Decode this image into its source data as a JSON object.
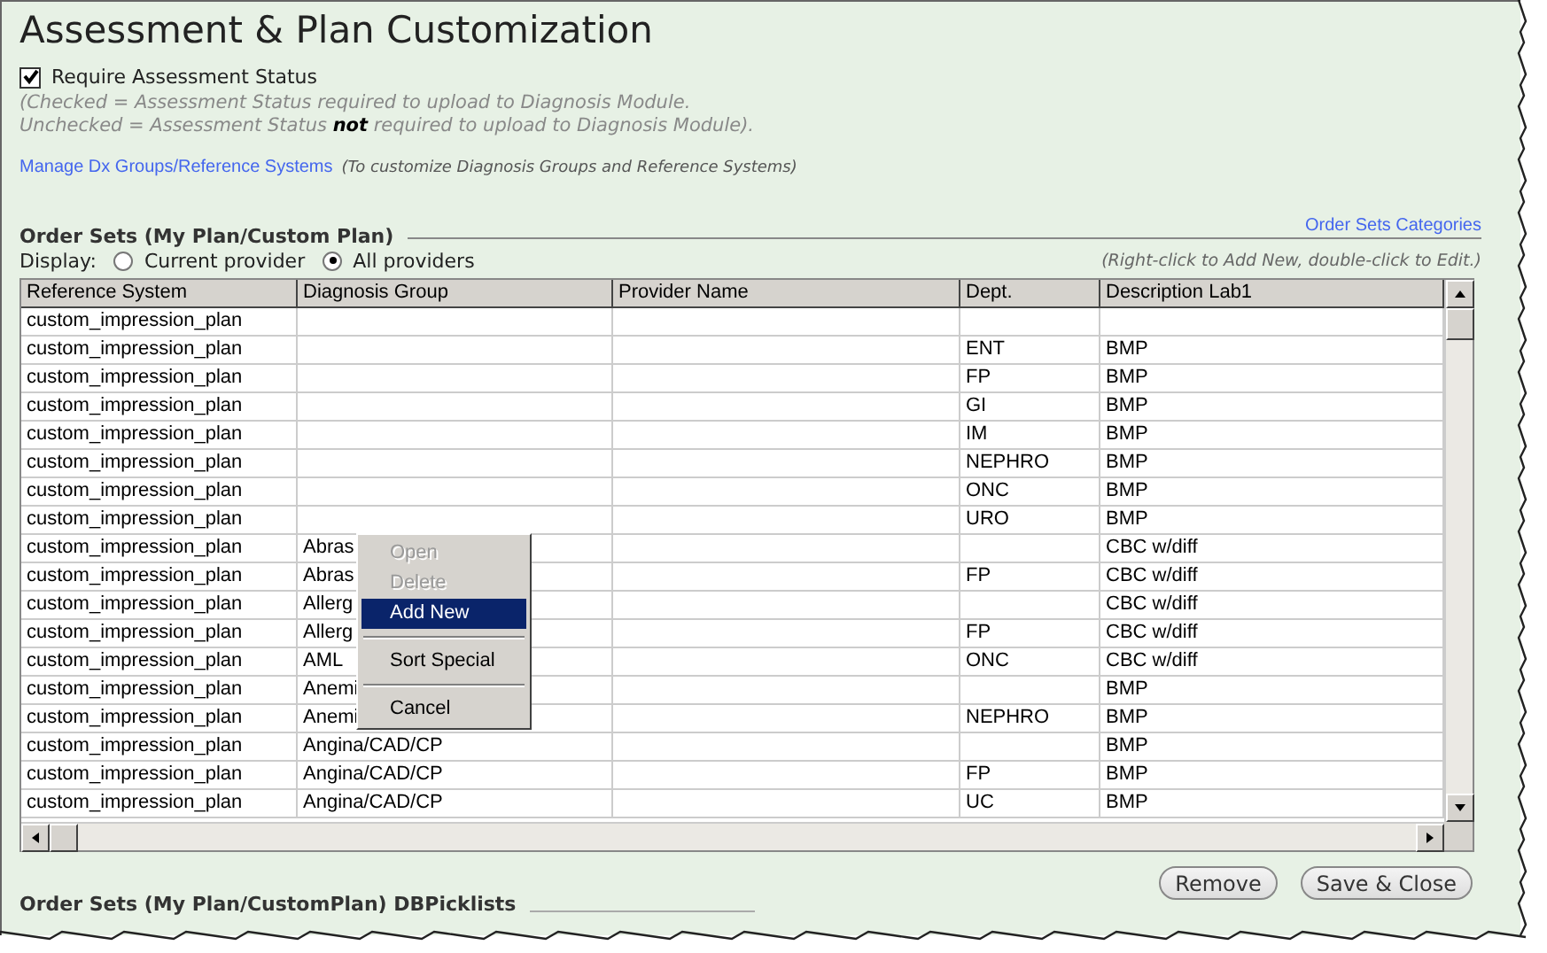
{
  "title": "Assessment & Plan Customization",
  "require_status": {
    "label": "Require Assessment Status",
    "checked": true
  },
  "status_note": [
    "(Checked = Assessment Status required to upload to Diagnosis Module.",
    "Unchecked = Assessment Status **not** required to upload to Diagnosis Module)."
  ],
  "manage_link": {
    "label": "Manage Dx Groups/Reference Systems",
    "note": "(To customize Diagnosis Groups and Reference Systems)"
  },
  "order_sets": {
    "heading": "Order Sets (My Plan/Custom Plan)",
    "categories_link": "Order Sets Categories",
    "display_label": "Display:",
    "display_options": [
      {
        "label": "Current provider",
        "selected": false
      },
      {
        "label": "All providers",
        "selected": true
      }
    ],
    "hint": "(Right-click to Add New, double-click to Edit.)",
    "table": {
      "columns": [
        "Reference System",
        "Diagnosis Group",
        "Provider Name",
        "Dept.",
        "Description Lab1"
      ],
      "rows": [
        [
          "custom_impression_plan",
          "",
          "",
          "",
          ""
        ],
        [
          "custom_impression_plan",
          "",
          "",
          "ENT",
          "BMP"
        ],
        [
          "custom_impression_plan",
          "",
          "",
          "FP",
          "BMP"
        ],
        [
          "custom_impression_plan",
          "",
          "",
          "GI",
          "BMP"
        ],
        [
          "custom_impression_plan",
          "",
          "",
          "IM",
          "BMP"
        ],
        [
          "custom_impression_plan",
          "",
          "",
          "NEPHRO",
          "BMP"
        ],
        [
          "custom_impression_plan",
          "",
          "",
          "ONC",
          "BMP"
        ],
        [
          "custom_impression_plan",
          "",
          "",
          "URO",
          "BMP"
        ],
        [
          "custom_impression_plan",
          "Abras",
          "",
          "",
          "CBC w/diff"
        ],
        [
          "custom_impression_plan",
          "Abras",
          "",
          "FP",
          "CBC w/diff"
        ],
        [
          "custom_impression_plan",
          "Allerg",
          "",
          "",
          "CBC w/diff"
        ],
        [
          "custom_impression_plan",
          "Allerg",
          "",
          "FP",
          "CBC w/diff"
        ],
        [
          "custom_impression_plan",
          "AML",
          "",
          "ONC",
          "CBC w/diff"
        ],
        [
          "custom_impression_plan",
          "Anemi",
          "",
          "",
          "BMP"
        ],
        [
          "custom_impression_plan",
          "Anemi",
          "",
          "NEPHRO",
          "BMP"
        ],
        [
          "custom_impression_plan",
          "Angina/CAD/CP",
          "",
          "",
          "BMP"
        ],
        [
          "custom_impression_plan",
          "Angina/CAD/CP",
          "",
          "FP",
          "BMP"
        ],
        [
          "custom_impression_plan",
          "Angina/CAD/CP",
          "",
          "UC",
          "BMP"
        ]
      ]
    },
    "context_menu": [
      {
        "kind": "item",
        "label": "Open",
        "disabled": true,
        "selected": false
      },
      {
        "kind": "item",
        "label": "Delete",
        "disabled": true,
        "selected": false
      },
      {
        "kind": "item",
        "label": "Add New",
        "disabled": false,
        "selected": true
      },
      {
        "kind": "separator"
      },
      {
        "kind": "item",
        "label": "Sort Special",
        "disabled": false,
        "selected": false
      },
      {
        "kind": "separator"
      },
      {
        "kind": "item",
        "label": "Cancel",
        "disabled": false,
        "selected": false
      }
    ]
  },
  "buttons": [
    "Remove",
    "Save & Close"
  ],
  "picklists_heading": "Order Sets (My Plan/CustomPlan) DBPicklists"
}
